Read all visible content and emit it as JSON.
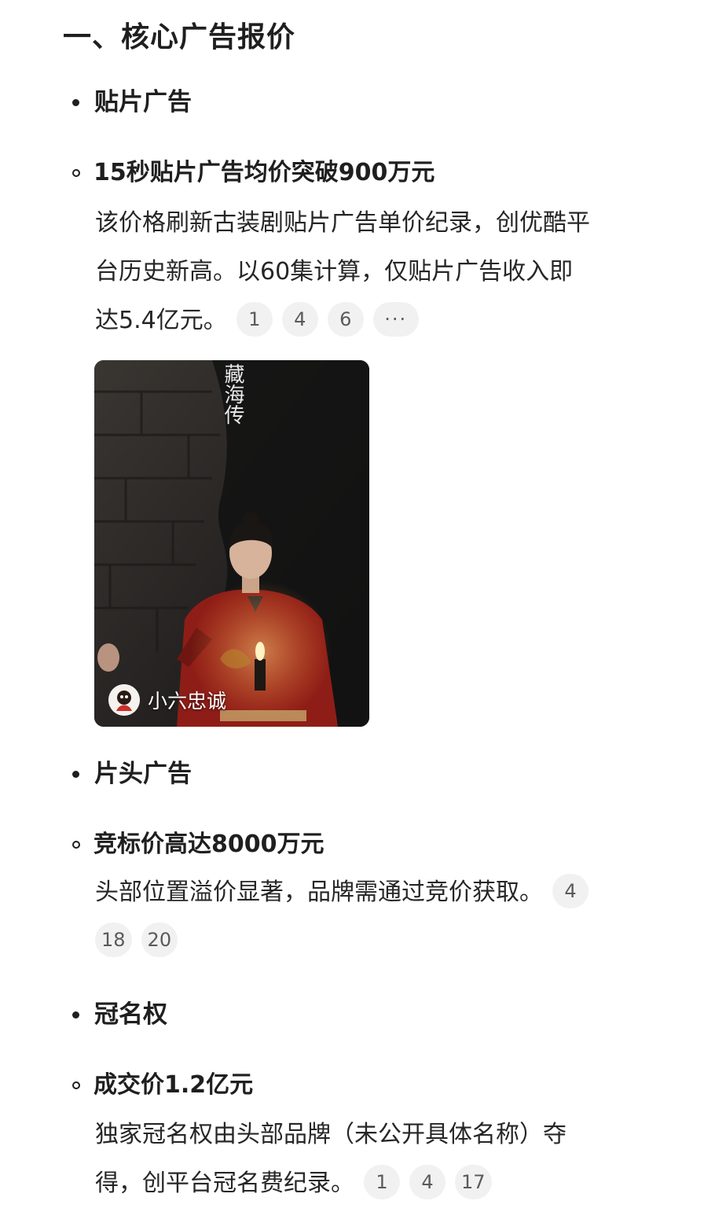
{
  "heading": "一、核心广告报价",
  "sections": [
    {
      "title": "贴片广告",
      "item": {
        "title": "15秒贴片广告均价突破900万元",
        "lines": [
          "该价格刷新古装剧贴片广告单价纪录，创优酷平",
          "台历史新高。以60集计算，仅贴片广告收入即",
          "达5.4亿元。"
        ],
        "refs": [
          "1",
          "4",
          "6"
        ],
        "more_label": "···"
      },
      "image": {
        "poster_title": "藏海传",
        "author": "小六忠诚"
      }
    },
    {
      "title": "片头广告",
      "item": {
        "title": "竞标价高达8000万元",
        "lines": [
          "头部位置溢价显著，品牌需通过竞价获取。"
        ],
        "refs_line1": [
          "4"
        ],
        "refs_line2": [
          "18",
          "20"
        ]
      }
    },
    {
      "title": "冠名权",
      "item": {
        "title": "成交价1.2亿元",
        "lines": [
          "独家冠名权由头部品牌（未公开具体名称）夺",
          "得，创平台冠名费纪录。"
        ],
        "refs": [
          "1",
          "4",
          "17"
        ]
      }
    }
  ],
  "colors": {
    "text": "#1f1f1f",
    "ref_bg": "#f1f1f1",
    "robe_red": "#8f1d17"
  }
}
